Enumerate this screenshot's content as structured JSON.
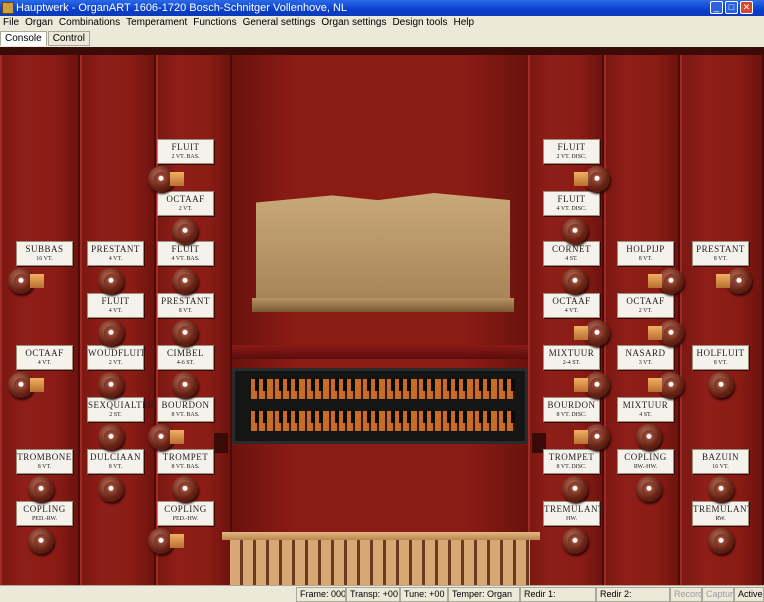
{
  "window": {
    "title": "Hauptwerk - OrganART 1606-1720  Bosch-Schnitger Vollenhove, NL"
  },
  "menu": [
    "File",
    "Organ",
    "Combinations",
    "Temperament",
    "Functions",
    "General settings",
    "Organ settings",
    "Design tools",
    "Help"
  ],
  "tabs": [
    "Console",
    "Control"
  ],
  "stops_left": [
    {
      "name": "FLUIT",
      "size": "2 VT. BAS."
    },
    {
      "name": "OCTAAF",
      "size": "2 VT."
    },
    {
      "name": "SUBBAS",
      "size": "16 VT."
    },
    {
      "name": "PRESTANT",
      "size": "4 VT."
    },
    {
      "name": "FLUIT",
      "size": "4 VT. BAS."
    },
    {
      "name": "FLUIT",
      "size": "4 VT."
    },
    {
      "name": "PRESTANT",
      "size": "8 VT."
    },
    {
      "name": "OCTAAF",
      "size": "4 VT."
    },
    {
      "name": "WOUDFLUIT",
      "size": "2 VT."
    },
    {
      "name": "CIMBEL",
      "size": "4-6 ST."
    },
    {
      "name": "SEXQUIALTER",
      "size": "2 ST."
    },
    {
      "name": "BOURDON",
      "size": "8 VT. BAS."
    },
    {
      "name": "TROMBONE",
      "size": "8 VT."
    },
    {
      "name": "DULCIAAN",
      "size": "8 VT."
    },
    {
      "name": "TROMPET",
      "size": "8 VT. BAS."
    },
    {
      "name": "COPLING",
      "size": "PED.-RW."
    },
    {
      "name": "COPLING",
      "size": "PED.-HW."
    }
  ],
  "stops_right": [
    {
      "name": "FLUIT",
      "size": "2 VT. DISC."
    },
    {
      "name": "FLUIT",
      "size": "4 VT. DISC."
    },
    {
      "name": "CORNET",
      "size": "4 ST."
    },
    {
      "name": "HOLPIJP",
      "size": "8 VT."
    },
    {
      "name": "PRESTANT",
      "size": "8 VT."
    },
    {
      "name": "OCTAAF",
      "size": "4 VT."
    },
    {
      "name": "OCTAAF",
      "size": "2 VT."
    },
    {
      "name": "MIXTUUR",
      "size": "2-4 ST."
    },
    {
      "name": "NASARD",
      "size": "3 VT."
    },
    {
      "name": "HOLFLUIT",
      "size": "8 VT."
    },
    {
      "name": "BOURDON",
      "size": "8 VT. DISC."
    },
    {
      "name": "MIXTUUR",
      "size": "4 ST."
    },
    {
      "name": "TROMPET",
      "size": "8 VT. DISC."
    },
    {
      "name": "COPLING",
      "size": "RW.-HW."
    },
    {
      "name": "BAZUIN",
      "size": "16 VT."
    },
    {
      "name": "TREMULANT",
      "size": "HW."
    },
    {
      "name": "TREMULANT",
      "size": "RW."
    }
  ],
  "status": {
    "frame": "Frame: 000",
    "transp": "Transp: +00",
    "tune": "Tune: +00",
    "temper": "Temper: Organ",
    "redir1": "Redir 1:",
    "redir2": "Redir 2:",
    "record": "Record",
    "capture": "Capture",
    "active": "Active"
  }
}
